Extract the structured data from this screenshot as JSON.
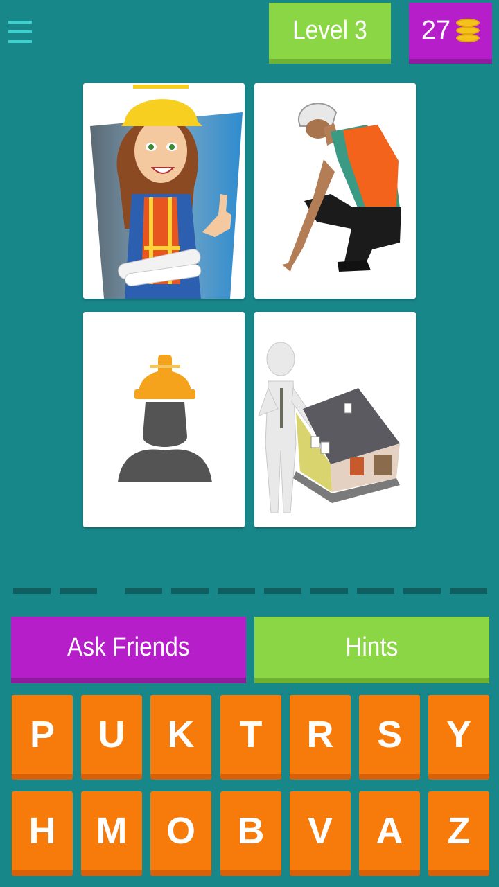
{
  "header": {
    "level_label": "Level 3",
    "coins": "27",
    "menu_icon": "hamburger-menu-icon",
    "coin_icon": "coin-stack-icon"
  },
  "puzzle": {
    "images": [
      {
        "name": "female-engineer-with-hardhat-and-blueprints"
      },
      {
        "name": "crouching-worker-in-orange-vest"
      },
      {
        "name": "worker-silhouette-with-hardhat"
      },
      {
        "name": "3d-figure-with-house-model"
      }
    ],
    "answer_slots": 10
  },
  "actions": {
    "ask_friends": "Ask Friends",
    "hints": "Hints"
  },
  "keyboard": {
    "row1": [
      "P",
      "U",
      "K",
      "T",
      "R",
      "S",
      "Y"
    ],
    "row2": [
      "H",
      "M",
      "O",
      "B",
      "V",
      "A",
      "Z"
    ]
  },
  "colors": {
    "background": "#17878a",
    "green": "#8ad645",
    "purple": "#b51ec8",
    "orange": "#f77b0b"
  }
}
